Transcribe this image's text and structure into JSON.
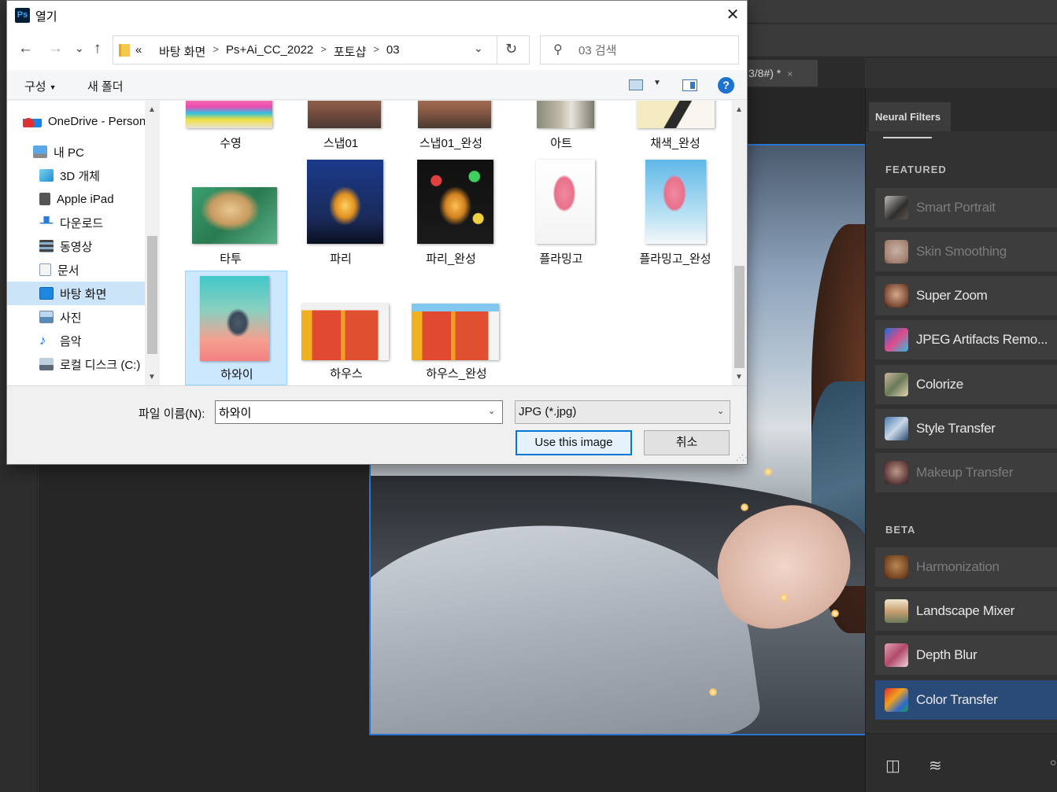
{
  "dialog": {
    "title": "열기",
    "app_icon": "Ps",
    "nav": {
      "back": "←",
      "forward": "→",
      "recent": "⌄",
      "up": "↑",
      "breadcrumb_prefix": "«",
      "breadcrumbs": [
        "바탕 화면",
        "Ps+Ai_CC_2022",
        "포토샵",
        "03"
      ],
      "refresh": "↻"
    },
    "search": {
      "placeholder": "03 검색"
    },
    "commands": {
      "organize": "구성",
      "new_folder": "새 폴더",
      "help": "?"
    },
    "nav_pane": [
      {
        "label": "OneDrive - Personal",
        "icon": "onedrive-icon"
      },
      {
        "label": "내 PC",
        "icon": "pc-icon"
      },
      {
        "label": "3D 개체",
        "icon": "3d-objects-icon"
      },
      {
        "label": "Apple iPad",
        "icon": "ipad-icon"
      },
      {
        "label": "다운로드",
        "icon": "download-icon"
      },
      {
        "label": "동영상",
        "icon": "video-icon"
      },
      {
        "label": "문서",
        "icon": "documents-icon"
      },
      {
        "label": "바탕 화면",
        "icon": "desktop-icon",
        "selected": true
      },
      {
        "label": "사진",
        "icon": "pictures-icon"
      },
      {
        "label": "음악",
        "icon": "music-icon"
      },
      {
        "label": "로컬 디스크 (C:)",
        "icon": "local-disk-icon"
      }
    ],
    "files": [
      {
        "name": "수영"
      },
      {
        "name": "스냅01"
      },
      {
        "name": "스냅01_완성"
      },
      {
        "name": "아트"
      },
      {
        "name": "채색_완성"
      },
      {
        "name": "타투"
      },
      {
        "name": "파리"
      },
      {
        "name": "파리_완성"
      },
      {
        "name": "플라밍고"
      },
      {
        "name": "플라밍고_완성"
      },
      {
        "name": "하와이",
        "selected": true
      },
      {
        "name": "하우스"
      },
      {
        "name": "하우스_완성"
      }
    ],
    "filename_label": "파일 이름(N):",
    "filename_value": "하와이",
    "filetype": "JPG (*.jpg)",
    "ok_button": "Use this image",
    "cancel_button": "취소"
  },
  "photoshop": {
    "doc_tab": "3/8#) *",
    "doc_tab_close": "×"
  },
  "neural_filters": {
    "tab": "Neural Filters",
    "featured_label": "FEATURED",
    "featured": [
      {
        "label": "Smart Portrait",
        "enabled": false
      },
      {
        "label": "Skin Smoothing",
        "enabled": false
      },
      {
        "label": "Super Zoom",
        "enabled": true
      },
      {
        "label": "JPEG Artifacts Remo...",
        "enabled": true
      },
      {
        "label": "Colorize",
        "enabled": true
      },
      {
        "label": "Style Transfer",
        "enabled": true
      },
      {
        "label": "Makeup Transfer",
        "enabled": false
      }
    ],
    "beta_label": "BETA",
    "beta": [
      {
        "label": "Harmonization",
        "enabled": false
      },
      {
        "label": "Landscape Mixer",
        "enabled": true
      },
      {
        "label": "Depth Blur",
        "enabled": true
      },
      {
        "label": "Color Transfer",
        "enabled": true,
        "selected": true
      }
    ]
  },
  "colors": {
    "selection_blue": "#cce8ff",
    "ok_border": "#0078d7",
    "ps_panel": "#323232",
    "nf_selected": "#2a4b78"
  }
}
